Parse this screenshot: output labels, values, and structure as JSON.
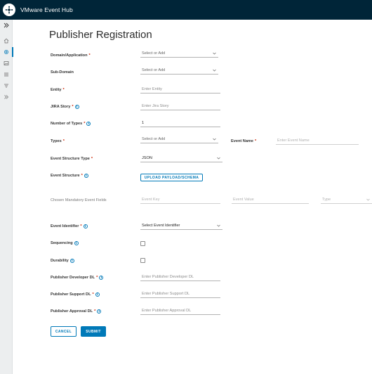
{
  "header": {
    "app_title": "VMware Event Hub"
  },
  "sidebar": {
    "items": [
      {
        "icon": "double-chevron-right-icon"
      },
      {
        "icon": "home-icon"
      },
      {
        "icon": "gear-icon",
        "active": true
      },
      {
        "icon": "image-icon"
      },
      {
        "icon": "list-icon"
      },
      {
        "icon": "filter-list-icon"
      },
      {
        "icon": "forward-icon"
      }
    ]
  },
  "page": {
    "title": "Publisher Registration"
  },
  "form": {
    "domain_application": {
      "label": "Domain/Application",
      "required": "*",
      "placeholder": "Select or Add"
    },
    "sub_domain": {
      "label": "Sub-Domain",
      "placeholder": "Select or Add"
    },
    "entity": {
      "label": "Entity",
      "required": "*",
      "placeholder": "Enter Entity"
    },
    "jira_story": {
      "label": "JIRA Story",
      "required": "*",
      "placeholder": "Enter Jira Story"
    },
    "number_of_types": {
      "label": "Number of Types",
      "required": "*",
      "value": "1"
    },
    "types": {
      "label": "Types",
      "required": "*",
      "placeholder": "Select or Add"
    },
    "event_name": {
      "label": "Event Name",
      "required": "*",
      "placeholder": "Enter Event Name"
    },
    "event_structure_type": {
      "label": "Event Structure Type",
      "required": "*",
      "value": "JSON"
    },
    "event_structure": {
      "label": "Event Structure",
      "required": "*",
      "button_label": "UPLOAD PAYLOAD/SCHEMA"
    },
    "mandatory_fields": {
      "label": "Chosen Mandatory Event Fields",
      "event_key_placeholder": "Event Key",
      "event_value_placeholder": "Event Value",
      "type_placeholder": "Type"
    },
    "event_identifier": {
      "label": "Event Identifier",
      "required": "*",
      "value": "Select Event Identifier"
    },
    "sequencing": {
      "label": "Sequencing",
      "checked": false
    },
    "durability": {
      "label": "Durability",
      "checked": false
    },
    "publisher_developer_dl": {
      "label": "Publisher Developer DL",
      "required": "*",
      "placeholder": "Enter Publisher Developer DL"
    },
    "publisher_support_dl": {
      "label": "Publisher Support DL",
      "required": "*",
      "placeholder": "Enter Publisher Support DL"
    },
    "publisher_approval_dl": {
      "label": "Publisher Approval DL",
      "required": "*",
      "placeholder": "Enter Publisher Approval DL"
    }
  },
  "actions": {
    "cancel_label": "CANCEL",
    "submit_label": "SUBMIT"
  },
  "colors": {
    "header_bg": "#002538",
    "accent": "#0079b8",
    "required": "#c92100"
  }
}
